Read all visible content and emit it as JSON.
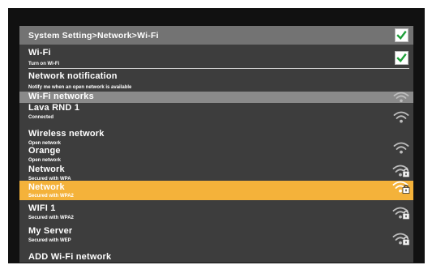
{
  "breadcrumb": "System Setting>Network>Wi-Fi",
  "wifi_toggle": {
    "title": "Wi-Fi",
    "subtitle": "Turn on Wi-Fi",
    "checked": true
  },
  "network_notification": {
    "title": "Network notification",
    "subtitle": "Notify me when an open network is available"
  },
  "networks_header": "Wi-Fi networks",
  "networks": [
    {
      "name": "Lava RND 1",
      "status": "Connected",
      "icon": "wifi-icon"
    },
    {
      "name": "Wireless network",
      "status": "Open network",
      "icon": "wifi-icon"
    },
    {
      "name": "Orange",
      "status": "Open network",
      "icon": "wifi-icon"
    },
    {
      "name": "Network",
      "status": "Secured with WPA",
      "icon": "wifi-lock-icon"
    },
    {
      "name": "Network",
      "status": "Secured with WPA2",
      "icon": "wifi-lock-icon",
      "selected": true
    },
    {
      "name": "WIFI 1",
      "status": "Secured with WPA2",
      "icon": "wifi-lock-icon"
    },
    {
      "name": "My Server",
      "status": "Secured with WEP",
      "icon": "wifi-lock-icon"
    }
  ],
  "add_network": "ADD Wi-Fi network",
  "colors": {
    "background": "#3d3d3d",
    "header_bar": "#737373",
    "section_bar": "#8a8a8a",
    "selected": "#f4b23a",
    "check_green": "#1f9f3a"
  }
}
